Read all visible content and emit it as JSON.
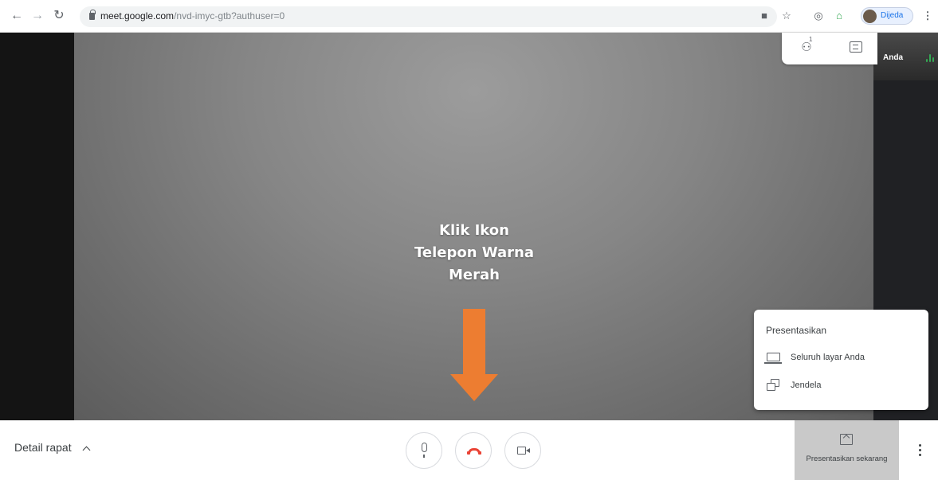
{
  "browser": {
    "url_host": "meet.google.com",
    "url_path": "/nvd-imyc-gtb?authuser=0",
    "profile_label": "Dijeda",
    "back_icon": "back-arrow-icon",
    "forward_icon": "forward-arrow-icon",
    "reload_icon": "reload-icon"
  },
  "meet": {
    "self_name": "Anda",
    "participants_badge": "1",
    "accent_hangup": "#ea4335",
    "accent_present": "#c9c9c9"
  },
  "annotation": {
    "line1": "Klik Ikon",
    "line2": "Telepon Warna",
    "line3": "Merah",
    "arrow_color": "#ed7d31"
  },
  "present_menu": {
    "title": "Presentasikan",
    "items": [
      {
        "label": "Seluruh layar Anda",
        "icon": "monitor-icon"
      },
      {
        "label": "Jendela",
        "icon": "window-icon"
      }
    ]
  },
  "bottombar": {
    "detail_label": "Detail rapat",
    "present_label": "Presentasikan sekarang"
  }
}
